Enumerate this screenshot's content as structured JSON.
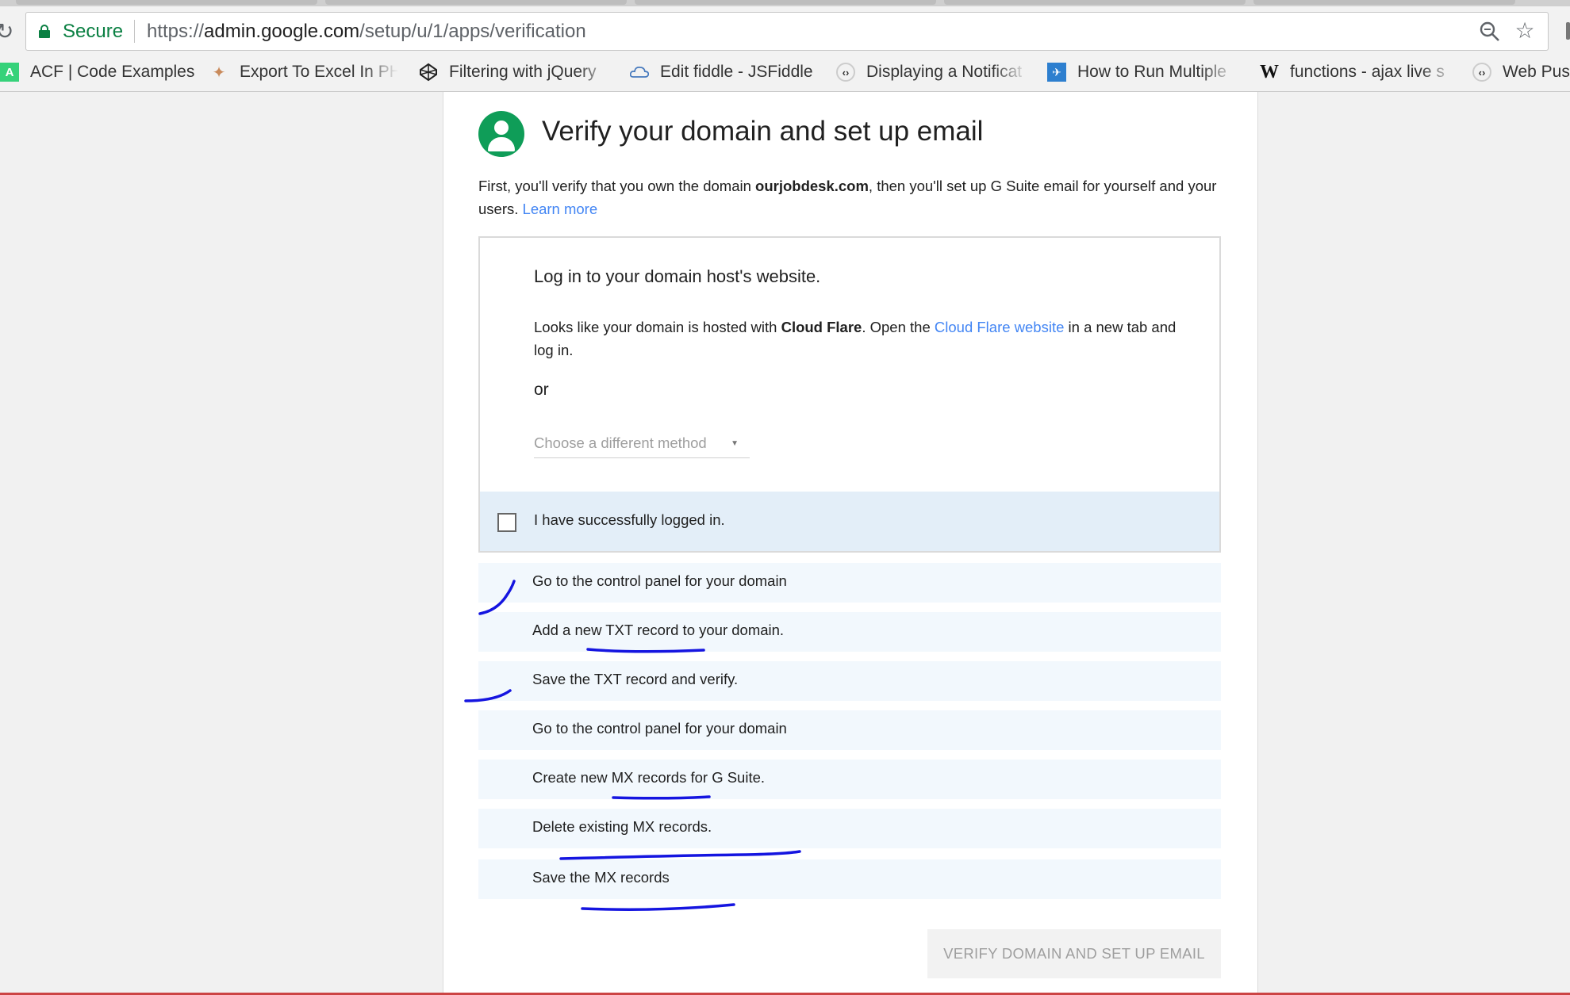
{
  "browser": {
    "secure_label": "Secure",
    "url_scheme": "https://",
    "url_host": "admin.google.com",
    "url_path": "/setup/u/1/apps/verification",
    "bookmarks": [
      {
        "label": "ACF | Code Examples",
        "icon": "acf-icon"
      },
      {
        "label": "Export To Excel In PH",
        "icon": "export-excel-icon"
      },
      {
        "label": "Filtering with jQuery",
        "icon": "codepen-icon"
      },
      {
        "label": "Edit fiddle - JSFiddle",
        "icon": "jsfiddle-icon"
      },
      {
        "label": "Displaying a Notificat",
        "icon": "code-brackets-icon"
      },
      {
        "label": "How to Run Multiple",
        "icon": "blue-tile-icon"
      },
      {
        "label": "functions - ajax live s",
        "icon": "w-icon"
      },
      {
        "label": "Web Pus",
        "icon": "code-brackets-icon"
      }
    ]
  },
  "page": {
    "title": "Verify your domain and set up email",
    "intro_prefix": "First, you'll verify that you own the domain ",
    "domain": "ourjobdesk.com",
    "intro_suffix": ", then you'll set up G Suite email for yourself and your users. ",
    "learn_more": "Learn more"
  },
  "login_box": {
    "title": "Log in to your domain host's website.",
    "text_prefix": "Looks like your domain is hosted with ",
    "host_name": "Cloud Flare",
    "text_middle": ". Open the ",
    "host_link": "Cloud Flare website",
    "text_suffix": " in a new tab and log in.",
    "or": "or",
    "method_select": "Choose a different method",
    "checkbox_label": "I have successfully logged in.",
    "checkbox_checked": false
  },
  "steps": [
    "Go to the control panel for your domain",
    "Add a new TXT record to your domain.",
    "Save the TXT record and verify.",
    "Go to the control panel for your domain",
    "Create new MX records for G Suite.",
    "Delete existing MX records.",
    "Save the MX records"
  ],
  "verify_button": "VERIFY DOMAIN AND SET UP EMAIL",
  "colors": {
    "accent_green": "#0f9d58",
    "link_blue": "#4285f4",
    "annotation_ink": "#1515e0"
  }
}
